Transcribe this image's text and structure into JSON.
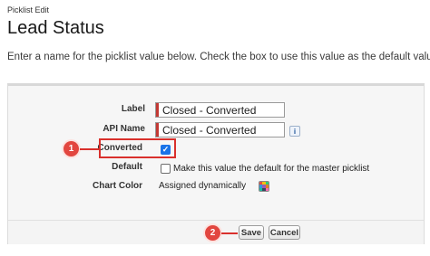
{
  "header": {
    "breadcrumb": "Picklist Edit",
    "title": "Lead Status",
    "intro": "Enter a name for the picklist value below. Check the box to use this value as the default value."
  },
  "form": {
    "label_label": "Label",
    "label_value": "Closed - Converted",
    "api_name_label": "API Name",
    "api_name_value": "Closed - Converted",
    "info_icon_glyph": "i",
    "converted_label": "Converted",
    "converted_checked": true,
    "default_label": "Default",
    "default_checked": false,
    "default_text": "Make this value the default for the master picklist",
    "chart_color_label": "Chart Color",
    "chart_color_value": "Assigned dynamically"
  },
  "annotations": {
    "step1": "1",
    "step2": "2",
    "highlight_color": "#d9302c"
  },
  "buttons": {
    "save": "Save",
    "cancel": "Cancel"
  },
  "icons": {
    "check": "check-icon",
    "info": "info-icon",
    "palette": "color-palette-icon"
  }
}
